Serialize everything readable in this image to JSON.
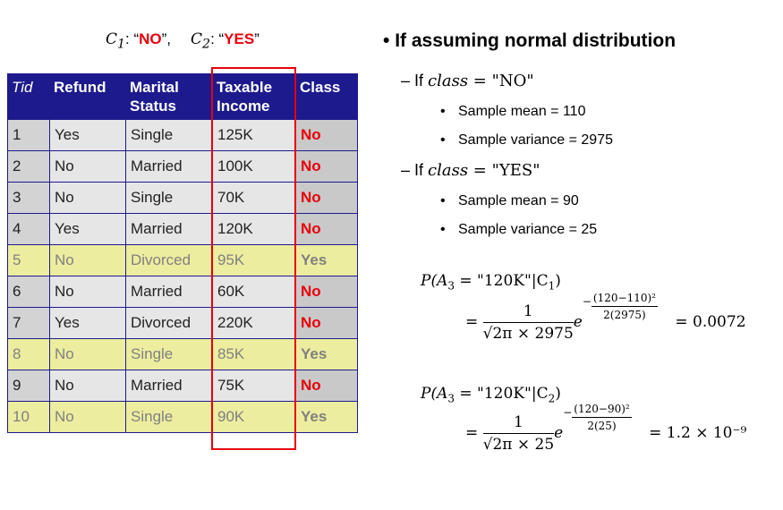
{
  "class_labels": {
    "c1_symbol": "C",
    "c1_sub": "1",
    "c1_value": "NO",
    "c2_symbol": "C",
    "c2_sub": "2",
    "c2_value": "YES"
  },
  "table": {
    "headers": [
      "Tid",
      "Refund",
      "Marital Status",
      "Taxable Income",
      "Class"
    ],
    "header_lines": {
      "marital_1": "Marital",
      "marital_2": "Status",
      "taxable_1": "Taxable",
      "taxable_2": "Income"
    },
    "rows": [
      {
        "tid": "1",
        "refund": "Yes",
        "marital": "Single",
        "income": "125K",
        "class": "No"
      },
      {
        "tid": "2",
        "refund": "No",
        "marital": "Married",
        "income": "100K",
        "class": "No"
      },
      {
        "tid": "3",
        "refund": "No",
        "marital": "Single",
        "income": "70K",
        "class": "No"
      },
      {
        "tid": "4",
        "refund": "Yes",
        "marital": "Married",
        "income": "120K",
        "class": "No"
      },
      {
        "tid": "5",
        "refund": "No",
        "marital": "Divorced",
        "income": "95K",
        "class": "Yes"
      },
      {
        "tid": "6",
        "refund": "No",
        "marital": "Married",
        "income": "60K",
        "class": "No"
      },
      {
        "tid": "7",
        "refund": "Yes",
        "marital": "Divorced",
        "income": "220K",
        "class": "No"
      },
      {
        "tid": "8",
        "refund": "No",
        "marital": "Single",
        "income": "85K",
        "class": "Yes"
      },
      {
        "tid": "9",
        "refund": "No",
        "marital": "Married",
        "income": "75K",
        "class": "No"
      },
      {
        "tid": "10",
        "refund": "No",
        "marital": "Single",
        "income": "90K",
        "class": "Yes"
      }
    ]
  },
  "colors": {
    "header_bg": "#1d1a8e",
    "no_color": "#e8000b",
    "yes_color": "#f08000",
    "yes_row_bg": "#ededa0",
    "highlight_border": "#e8000b"
  },
  "panel": {
    "heading": "If assuming normal distribution",
    "no_case": {
      "prefix": "If ",
      "var": "class",
      "eq": " = ",
      "value": "\"NO\"",
      "mean": "Sample mean = 110",
      "variance": "Sample variance = 2975"
    },
    "yes_case": {
      "prefix": "If ",
      "var": "class",
      "eq": " = ",
      "value": "\"YES\"",
      "mean": "Sample mean = 90",
      "variance": "Sample variance = 25"
    },
    "formula1": {
      "lhs": "P(A",
      "lhs_sub": "3",
      "lhs_rest": " = \"120K\"|C",
      "lhs_csub": "1",
      "lhs_close": ")",
      "numer": "1",
      "denom": "√2π × 2975",
      "e": "e",
      "exp_num": "(120−110)²",
      "exp_den": "2(2975)",
      "result": "= 0.0072"
    },
    "formula2": {
      "lhs": "P(A",
      "lhs_sub": "3",
      "lhs_rest": " = \"120K\"|C",
      "lhs_csub": "2",
      "lhs_close": ")",
      "numer": "1",
      "denom": "√2π × 25",
      "e": "e",
      "exp_num": "(120−90)²",
      "exp_den": "2(25)",
      "result": "= 1.2 × 10⁻⁹"
    }
  }
}
